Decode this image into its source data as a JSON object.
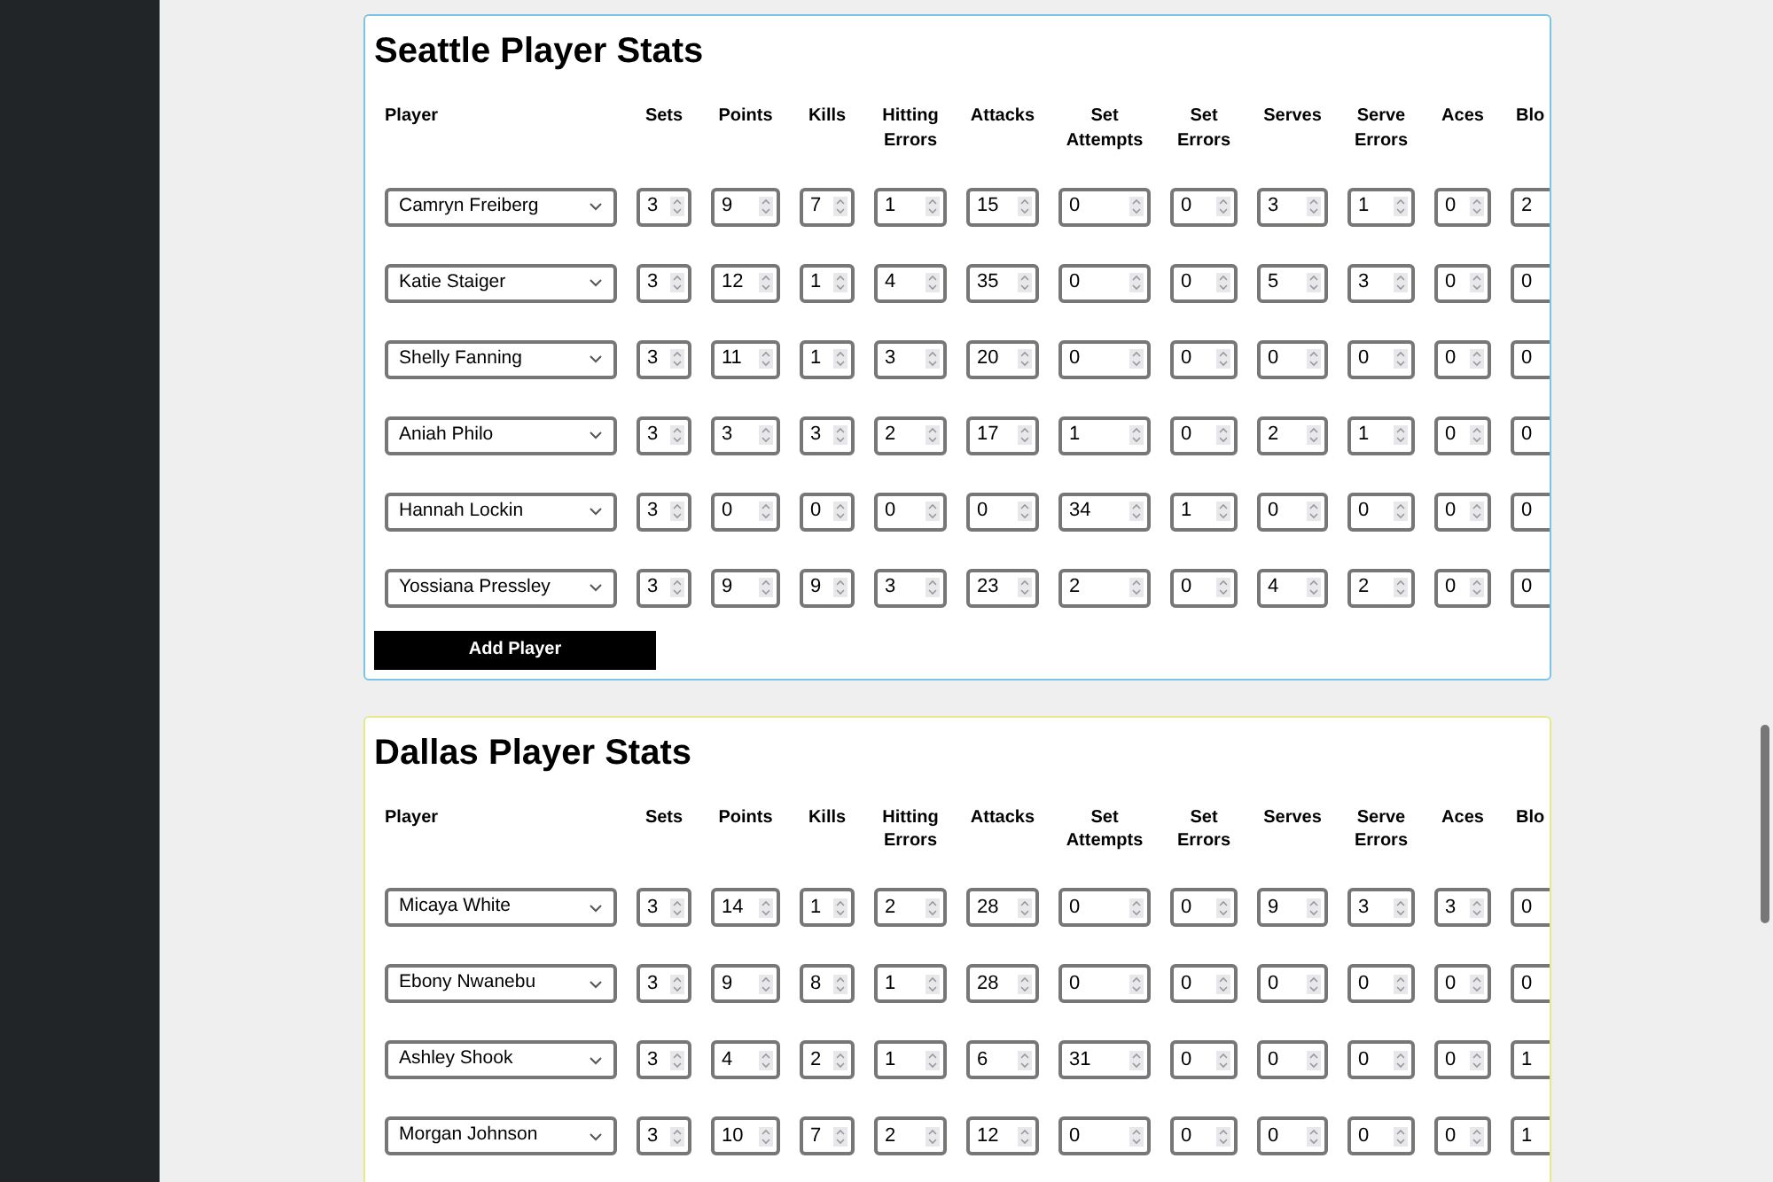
{
  "sections": [
    {
      "title": "Seattle Player Stats",
      "color": "#7cc4e4",
      "columns": [
        "Player",
        "Sets",
        "Points",
        "Kills",
        "Hitting Errors",
        "Attacks",
        "Set Attempts",
        "Set Errors",
        "Serves",
        "Serve Errors",
        "Aces",
        "Blo"
      ],
      "rows": [
        {
          "player": "Camryn Freiberg",
          "stats": [
            "3",
            "9",
            "7",
            "1",
            "15",
            "0",
            "0",
            "3",
            "1",
            "0",
            "2"
          ]
        },
        {
          "player": "Katie Staiger",
          "stats": [
            "3",
            "12",
            "1",
            "4",
            "35",
            "0",
            "0",
            "5",
            "3",
            "0",
            "0"
          ]
        },
        {
          "player": "Shelly Fanning",
          "stats": [
            "3",
            "11",
            "1",
            "3",
            "20",
            "0",
            "0",
            "0",
            "0",
            "0",
            "0"
          ]
        },
        {
          "player": "Aniah Philo",
          "stats": [
            "3",
            "3",
            "3",
            "2",
            "17",
            "1",
            "0",
            "2",
            "1",
            "0",
            "0"
          ]
        },
        {
          "player": "Hannah Lockin",
          "stats": [
            "3",
            "0",
            "0",
            "0",
            "0",
            "34",
            "1",
            "0",
            "0",
            "0",
            "0"
          ]
        },
        {
          "player": "Yossiana Pressley",
          "stats": [
            "3",
            "9",
            "9",
            "3",
            "23",
            "2",
            "0",
            "4",
            "2",
            "0",
            "0"
          ]
        }
      ],
      "add_button": "Add Player"
    },
    {
      "title": "Dallas Player Stats",
      "color": "#e4e98a",
      "columns": [
        "Player",
        "Sets",
        "Points",
        "Kills",
        "Hitting Errors",
        "Attacks",
        "Set Attempts",
        "Set Errors",
        "Serves",
        "Serve Errors",
        "Aces",
        "Blo"
      ],
      "rows": [
        {
          "player": "Micaya White",
          "stats": [
            "3",
            "14",
            "1",
            "2",
            "28",
            "0",
            "0",
            "9",
            "3",
            "3",
            "0"
          ]
        },
        {
          "player": "Ebony Nwanebu",
          "stats": [
            "3",
            "9",
            "8",
            "1",
            "28",
            "0",
            "0",
            "0",
            "0",
            "0",
            "0"
          ]
        },
        {
          "player": "Ashley Shook",
          "stats": [
            "3",
            "4",
            "2",
            "1",
            "6",
            "31",
            "0",
            "0",
            "0",
            "0",
            "1"
          ]
        },
        {
          "player": "Morgan Johnson",
          "stats": [
            "3",
            "10",
            "7",
            "2",
            "12",
            "0",
            "0",
            "0",
            "0",
            "0",
            "1"
          ]
        }
      ]
    }
  ]
}
